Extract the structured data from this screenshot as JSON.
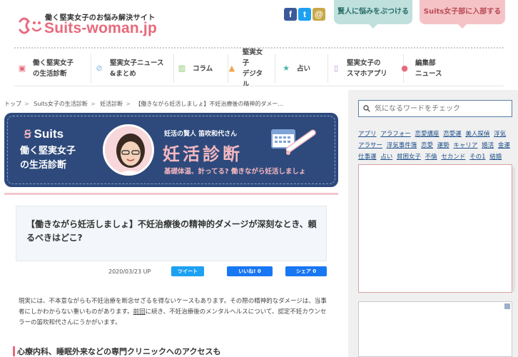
{
  "header": {
    "tagline": "働く堅実女子のお悩み解決サイト",
    "logo": "Suits-woman.jp",
    "social": [
      {
        "name": "facebook-icon",
        "glyph": "f"
      },
      {
        "name": "twitter-icon",
        "glyph": "t"
      },
      {
        "name": "line-icon",
        "glyph": "@"
      }
    ],
    "consult_button": "賢人に悩みをぶつける",
    "join_button": "Suits女子部に入部する"
  },
  "nav": {
    "items": [
      {
        "label": "働く堅実女子\nの生活診断",
        "icon": "clipboard-icon"
      },
      {
        "label": "堅実女子ニュース\n&まとめ",
        "icon": "paperclip-icon"
      },
      {
        "label": "コラム",
        "icon": "book-icon"
      },
      {
        "label": "堅実女子\nデジタル",
        "icon": "bag-icon"
      },
      {
        "label": "占い",
        "icon": "star-icon"
      },
      {
        "label": "堅実女子の\nスマホアプリ",
        "icon": "smartphone-icon"
      },
      {
        "label": "編集部\nニュース",
        "icon": "speech-bubble-icon"
      }
    ]
  },
  "breadcrumb": [
    "トップ",
    "Suits女子の生活診断",
    "妊活診断",
    "【働きながら妊活しましょ】不妊治療後の精神的ダメー..."
  ],
  "banner": {
    "brand": "Suits",
    "series": "働く堅実女子\nの生活診断",
    "byline": "妊活の賢人 笛吹和代さん",
    "title": "妊活診断",
    "subtitle": "基礎体温、計ってる? 働きながら妊活しましょ"
  },
  "article": {
    "title": "【働きながら妊活しましょ】不妊治療後の精神的ダメージが深刻なとき、頼るべきはどこ?",
    "date": "2020/03/23 UP",
    "tweet_label": "ツイート",
    "like_label": "いいね! 0",
    "share_label": "シェア 0",
    "body_1": "現実には、不本意ながらも不妊治療を断念せざるを得ないケースもあります。その際の精神的なダメージは、当事者にしかわからない重いものがあります。",
    "body_link": "前回",
    "body_2": "に続き、不妊治療後のメンタルヘルスについて、認定不妊カウンセラーの笛吹和代さんにうかがいます。",
    "heading": "心療内科、睡眠外来などの専門クリニックへのアクセスも"
  },
  "sidebar": {
    "search_placeholder": "気になるワードをチェック",
    "tags": [
      "アプリ",
      "アラフォー",
      "恋愛講座",
      "恋愛運",
      "美人探偵",
      "浮気",
      "アラサー",
      "浮気事件簿",
      "恋愛",
      "運勢",
      "キャリア",
      "婚活",
      "金運",
      "仕事運",
      "占い",
      "貧困女子",
      "不倫",
      "セカンド",
      "その1",
      "結婚"
    ]
  },
  "colors": {
    "brand_pink": "#e8697c",
    "banner_navy": "#2e4a7c",
    "consult_teal": "#bfe0dd",
    "join_pink": "#f5c3c6"
  }
}
